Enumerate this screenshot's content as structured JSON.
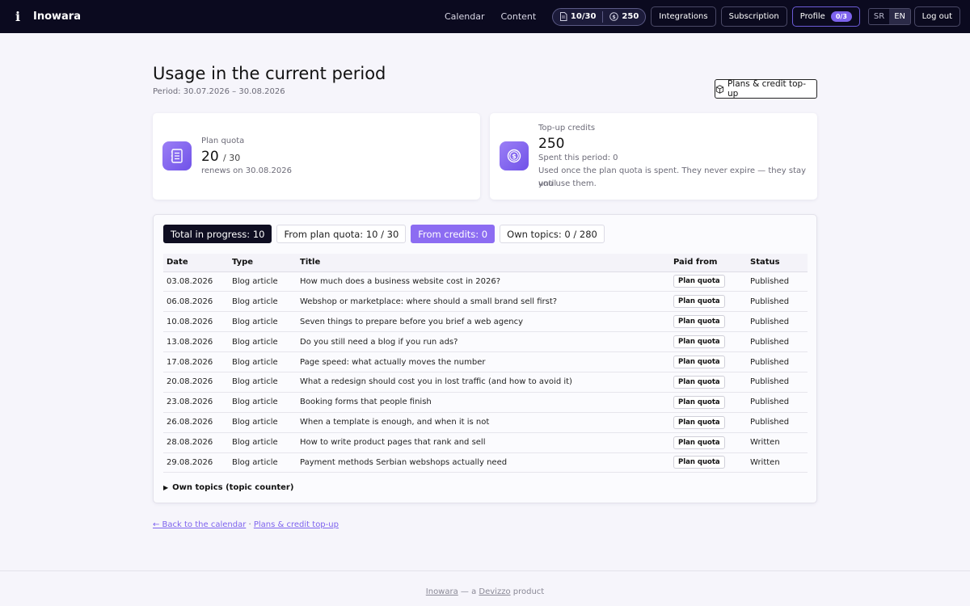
{
  "brand": {
    "logo_char": "i",
    "name": "Inowara"
  },
  "nav": [
    {
      "label": "Calendar"
    },
    {
      "label": "Content"
    }
  ],
  "topbar": {
    "articles_count": "10/30",
    "credits_count": "250",
    "integrations_label": "Integrations",
    "subscription_label": "Subscription",
    "profile_label": "Profile",
    "profile_badge": "0/3",
    "lang_sr": "SR",
    "lang_en": "EN",
    "logout_label": "Log out"
  },
  "header": {
    "title": "Usage in the current period",
    "period": "Period: 30.07.2026 – 30.08.2026",
    "plans_button": "Plans & credit top-up"
  },
  "quota_card": {
    "label": "Plan quota",
    "used": "20",
    "total": "/ 30",
    "renews": "renews on 30.08.2026"
  },
  "credits_card": {
    "label": "Top-up credits",
    "value": "250",
    "spent": "Spent this period: 0",
    "note_line1": "Used once the plan quota is spent. They never expire — they stay until",
    "note_line2": "you use them."
  },
  "chips": [
    {
      "label": "Total in progress: 10"
    },
    {
      "label": "From plan quota: 10 / 30"
    },
    {
      "label": "From credits: 0"
    },
    {
      "label": "Own topics: 0 / 280"
    }
  ],
  "table": {
    "headers": [
      "Date",
      "Type",
      "Title",
      "Paid from",
      "Status"
    ],
    "rows": [
      {
        "date": "03.08.2026",
        "type": "Blog article",
        "title": "How much does a business website cost in 2026?",
        "paid": "Plan quota",
        "status": "Published"
      },
      {
        "date": "06.08.2026",
        "type": "Blog article",
        "title": "Webshop or marketplace: where should a small brand sell first?",
        "paid": "Plan quota",
        "status": "Published"
      },
      {
        "date": "10.08.2026",
        "type": "Blog article",
        "title": "Seven things to prepare before you brief a web agency",
        "paid": "Plan quota",
        "status": "Published"
      },
      {
        "date": "13.08.2026",
        "type": "Blog article",
        "title": "Do you still need a blog if you run ads?",
        "paid": "Plan quota",
        "status": "Published"
      },
      {
        "date": "17.08.2026",
        "type": "Blog article",
        "title": "Page speed: what actually moves the number",
        "paid": "Plan quota",
        "status": "Published"
      },
      {
        "date": "20.08.2026",
        "type": "Blog article",
        "title": "What a redesign should cost you in lost traffic (and how to avoid it)",
        "paid": "Plan quota",
        "status": "Published"
      },
      {
        "date": "23.08.2026",
        "type": "Blog article",
        "title": "Booking forms that people finish",
        "paid": "Plan quota",
        "status": "Published"
      },
      {
        "date": "26.08.2026",
        "type": "Blog article",
        "title": "When a template is enough, and when it is not",
        "paid": "Plan quota",
        "status": "Published"
      },
      {
        "date": "28.08.2026",
        "type": "Blog article",
        "title": "How to write product pages that rank and sell",
        "paid": "Plan quota",
        "status": "Written"
      },
      {
        "date": "29.08.2026",
        "type": "Blog article",
        "title": "Payment methods Serbian webshops actually need",
        "paid": "Plan quota",
        "status": "Written"
      }
    ]
  },
  "details_label": "Own topics (topic counter)",
  "bottom_links": {
    "back": "← Back to the calendar",
    "sep": " · ",
    "plans": "Plans & credit top-up"
  },
  "footer": {
    "brand": "Inowara",
    "middle": " — a ",
    "company": "Devizzo",
    "suffix": " product"
  },
  "colors": {
    "accent": "#7d63ee",
    "topbar": "#0b0a1f"
  }
}
